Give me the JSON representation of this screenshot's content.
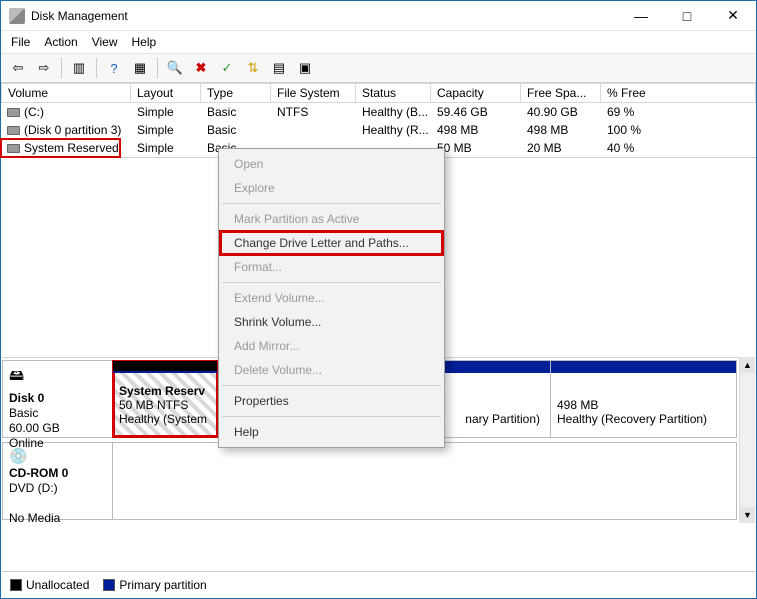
{
  "window": {
    "title": "Disk Management"
  },
  "menu": {
    "file": "File",
    "action": "Action",
    "view": "View",
    "help": "Help"
  },
  "columns": {
    "volume": "Volume",
    "layout": "Layout",
    "type": "Type",
    "filesystem": "File System",
    "status": "Status",
    "capacity": "Capacity",
    "free": "Free Spa...",
    "pct": "% Free"
  },
  "volumes": [
    {
      "name": "(C:)",
      "layout": "Simple",
      "type": "Basic",
      "fs": "NTFS",
      "status": "Healthy (B...",
      "cap": "59.46 GB",
      "free": "40.90 GB",
      "pct": "69 %"
    },
    {
      "name": "(Disk 0 partition 3)",
      "layout": "Simple",
      "type": "Basic",
      "fs": "",
      "status": "Healthy (R...",
      "cap": "498 MB",
      "free": "498 MB",
      "pct": "100 %"
    },
    {
      "name": "System Reserved",
      "layout": "Simple",
      "type": "Basic",
      "fs": "",
      "status": "",
      "cap": "50 MB",
      "free": "20 MB",
      "pct": "40 %"
    }
  ],
  "disk0": {
    "title": "Disk 0",
    "kind": "Basic",
    "size": "60.00 GB",
    "state": "Online",
    "parts": [
      {
        "title": "System Reserv",
        "line2": "50 MB NTFS",
        "line3": "Healthy (System"
      },
      {
        "line3": "nary Partition)"
      },
      {
        "line2": "498 MB",
        "line3": "Healthy (Recovery Partition)"
      }
    ]
  },
  "cdrom": {
    "title": "CD-ROM 0",
    "kind": "DVD (D:)",
    "state": "No Media"
  },
  "legend": {
    "unallocated": "Unallocated",
    "primary": "Primary partition"
  },
  "ctx": {
    "open": "Open",
    "explore": "Explore",
    "mark_active": "Mark Partition as Active",
    "change_letter": "Change Drive Letter and Paths...",
    "format": "Format...",
    "extend": "Extend Volume...",
    "shrink": "Shrink Volume...",
    "add_mirror": "Add Mirror...",
    "delete": "Delete Volume...",
    "properties": "Properties",
    "help": "Help"
  }
}
